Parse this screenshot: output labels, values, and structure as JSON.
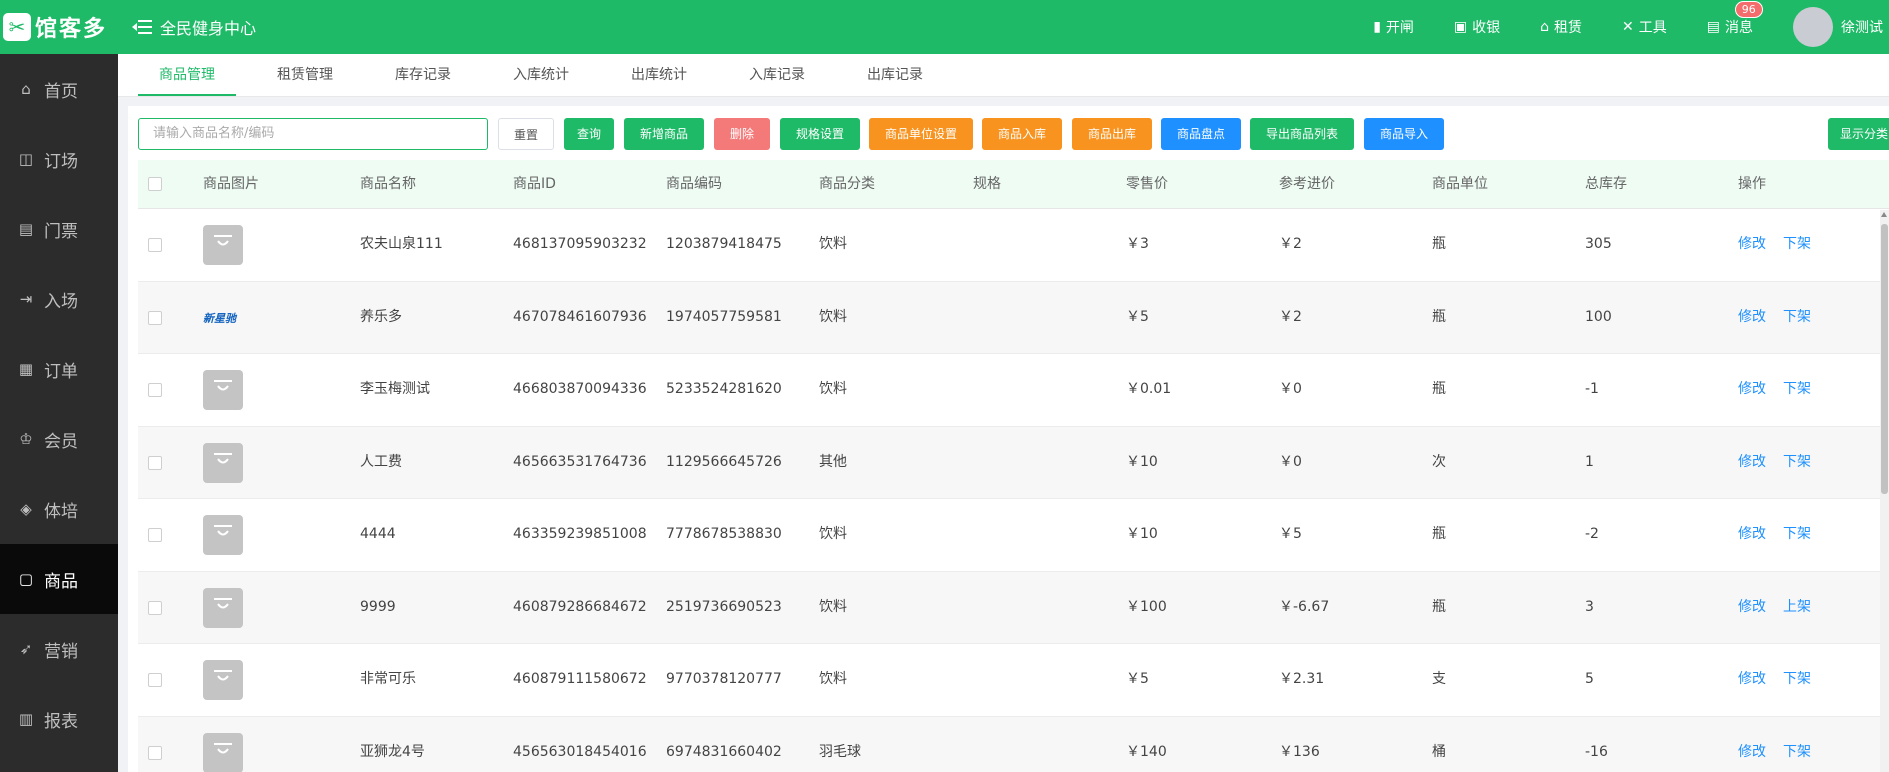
{
  "header": {
    "logo_text": "馆客多",
    "venue": "全民健身中心",
    "nav": [
      {
        "label": "开闸",
        "icon": "gate-icon"
      },
      {
        "label": "收银",
        "icon": "cashier-icon"
      },
      {
        "label": "租赁",
        "icon": "home-icon"
      },
      {
        "label": "工具",
        "icon": "tools-icon"
      },
      {
        "label": "消息",
        "icon": "message-icon",
        "badge": "96"
      }
    ],
    "user": "徐测试"
  },
  "sidebar": {
    "items": [
      {
        "label": "首页",
        "icon": "home-icon"
      },
      {
        "label": "订场",
        "icon": "booking-icon"
      },
      {
        "label": "门票",
        "icon": "ticket-icon"
      },
      {
        "label": "入场",
        "icon": "entry-icon"
      },
      {
        "label": "订单",
        "icon": "order-icon"
      },
      {
        "label": "会员",
        "icon": "member-icon"
      },
      {
        "label": "体培",
        "icon": "training-icon"
      },
      {
        "label": "商品",
        "icon": "goods-icon"
      },
      {
        "label": "营销",
        "icon": "marketing-icon"
      },
      {
        "label": "报表",
        "icon": "report-icon"
      }
    ],
    "active": "商品"
  },
  "tabs": [
    "商品管理",
    "租赁管理",
    "库存记录",
    "入库统计",
    "出库统计",
    "入库记录",
    "出库记录"
  ],
  "toolbar": {
    "search_placeholder": "请输入商品名称/编码",
    "buttons": [
      "重置",
      "查询",
      "新增商品",
      "删除",
      "规格设置",
      "商品单位设置",
      "商品入库",
      "商品出库",
      "商品盘点",
      "导出商品列表",
      "商品导入",
      "显示分类"
    ]
  },
  "table": {
    "columns": [
      "商品图片",
      "商品名称",
      "商品ID",
      "商品编码",
      "商品分类",
      "规格",
      "零售价",
      "参考进价",
      "商品单位",
      "总库存",
      "操作"
    ],
    "rows": [
      {
        "name": "农夫山泉111",
        "id": "468137095903232",
        "code": "1203879418475",
        "category": "饮料",
        "spec": "",
        "price": "￥3",
        "cost": "￥2",
        "unit": "瓶",
        "stock": "305",
        "edit": "修改",
        "toggle": "下架",
        "image": "placeholder"
      },
      {
        "name": "养乐多",
        "id": "467078461607936",
        "code": "1974057759581",
        "category": "饮料",
        "spec": "",
        "price": "￥5",
        "cost": "￥2",
        "unit": "瓶",
        "stock": "100",
        "edit": "修改",
        "toggle": "下架",
        "image": "brand",
        "brand_text": "新星驰"
      },
      {
        "name": "李玉梅测试",
        "id": "466803870094336",
        "code": "5233524281620",
        "category": "饮料",
        "spec": "",
        "price": "￥0.01",
        "cost": "￥0",
        "unit": "瓶",
        "stock": "-1",
        "edit": "修改",
        "toggle": "下架",
        "image": "placeholder"
      },
      {
        "name": "人工费",
        "id": "465663531764736",
        "code": "1129566645726",
        "category": "其他",
        "spec": "",
        "price": "￥10",
        "cost": "￥0",
        "unit": "次",
        "stock": "1",
        "edit": "修改",
        "toggle": "下架",
        "image": "placeholder"
      },
      {
        "name": "4444",
        "id": "463359239851008",
        "code": "7778678538830",
        "category": "饮料",
        "spec": "",
        "price": "￥10",
        "cost": "￥5",
        "unit": "瓶",
        "stock": "-2",
        "edit": "修改",
        "toggle": "下架",
        "image": "placeholder"
      },
      {
        "name": "9999",
        "id": "460879286684672",
        "code": "2519736690523",
        "category": "饮料",
        "spec": "",
        "price": "￥100",
        "cost": "￥-6.67",
        "unit": "瓶",
        "stock": "3",
        "edit": "修改",
        "toggle": "上架",
        "image": "placeholder"
      },
      {
        "name": "非常可乐",
        "id": "460879111580672",
        "code": "9770378120777",
        "category": "饮料",
        "spec": "",
        "price": "￥5",
        "cost": "￥2.31",
        "unit": "支",
        "stock": "5",
        "edit": "修改",
        "toggle": "下架",
        "image": "placeholder"
      },
      {
        "name": "亚狮龙4号",
        "id": "456563018454016",
        "code": "6974831660402",
        "category": "羽毛球",
        "spec": "",
        "price": "￥140",
        "cost": "￥136",
        "unit": "桶",
        "stock": "-16",
        "edit": "修改",
        "toggle": "下架",
        "image": "placeholder"
      }
    ]
  },
  "colors": {
    "primary": "#1fba68",
    "sidebar": "#2c2c2c",
    "danger": "#f47a7a",
    "warning": "#f7931e",
    "info": "#1e90ff"
  }
}
